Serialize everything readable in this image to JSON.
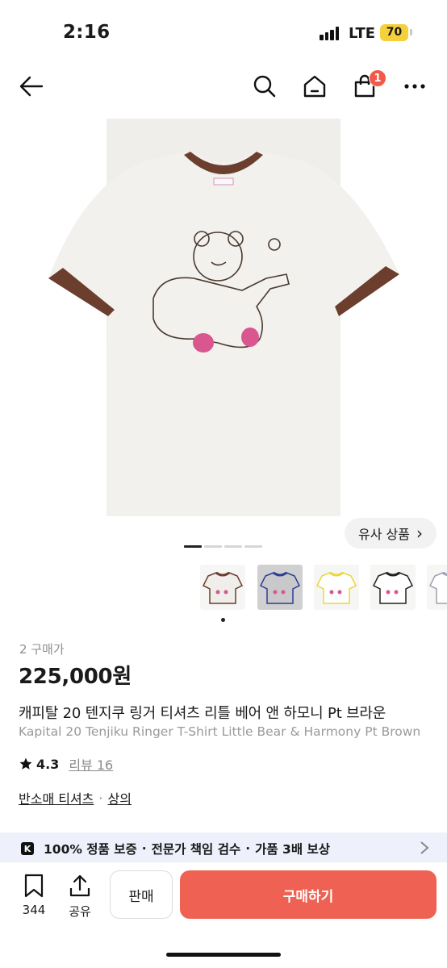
{
  "status_bar": {
    "time": "2:16",
    "network": "LTE",
    "battery": "70"
  },
  "nav": {
    "cart_count": "1"
  },
  "similar_button": {
    "label": "유사 상품",
    "chevron": "›"
  },
  "carousel": {
    "pages": 4,
    "active_page": 1
  },
  "thumbnails": [
    {
      "name": "brown trim",
      "trim_color": "#6b3e2e",
      "body_color": "#efeeea"
    },
    {
      "name": "navy trim",
      "trim_color": "#2d3f8f",
      "body_color": "#cfcfd0"
    },
    {
      "name": "yellow trim",
      "trim_color": "#e8d83a",
      "body_color": "#f7f7f5"
    },
    {
      "name": "black trim",
      "trim_color": "#222222",
      "body_color": "#f7f7f5"
    },
    {
      "name": "light trim",
      "trim_color": "#9aa0b0",
      "body_color": "#f7f7f5"
    }
  ],
  "product": {
    "buy_count": "2 구매가",
    "price": "225,000원",
    "title_ko": "캐피탈 20 텐지쿠 링거 티셔츠 리틀 베어 앤 하모니 Pt 브라운",
    "title_en": "Kapital 20 Tenjiku Ringer T-Shirt Little Bear & Harmony Pt Brown",
    "rating": "4.3",
    "review_label": "리뷰 16",
    "category_1": "반소매 티셔츠",
    "category_sep": "·",
    "category_2": "상의"
  },
  "guarantee": {
    "logo": "K",
    "item_1": "100% 정품 보증",
    "item_2": "전문가 책임 검수",
    "item_3": "가품 3배 보상",
    "dot": "·"
  },
  "bottom_bar": {
    "save_count": "344",
    "share_label": "공유",
    "sell_label": "판매",
    "buy_label": "구매하기"
  },
  "colors": {
    "accent": "#ef6253",
    "badge": "#f2594b",
    "trim": "#6b3e2e",
    "guarantee_bg": "#eef1fb"
  }
}
